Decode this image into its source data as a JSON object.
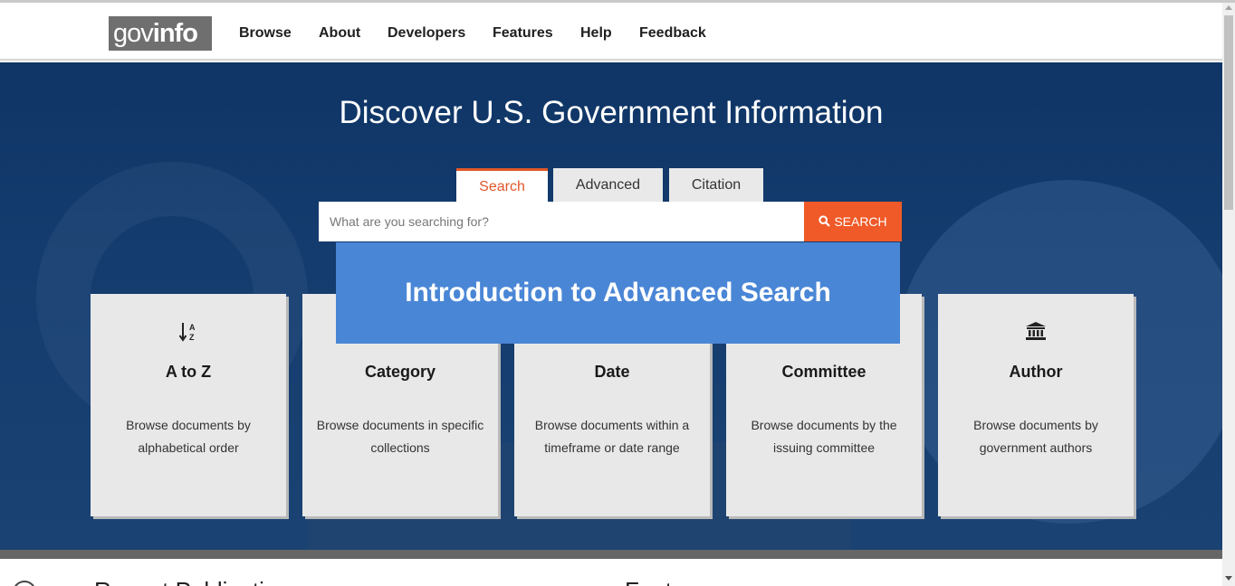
{
  "header": {
    "logo_gov": "gov",
    "logo_info": "info",
    "nav": [
      "Browse",
      "About",
      "Developers",
      "Features",
      "Help",
      "Feedback"
    ]
  },
  "hero": {
    "title": "Discover U.S. Government Information",
    "tabs": [
      "Search",
      "Advanced",
      "Citation"
    ],
    "active_tab": "Search",
    "search": {
      "placeholder": "What are you searching for?",
      "button_label": "SEARCH"
    }
  },
  "overlay": {
    "text": "Introduction to Advanced Search"
  },
  "cards": [
    {
      "icon": "sort-alpha-icon",
      "title": "A to Z",
      "desc": "Browse documents by alphabetical order"
    },
    {
      "icon": "category-icon",
      "title": "Category",
      "desc": "Browse documents in specific collections"
    },
    {
      "icon": "calendar-icon",
      "title": "Date",
      "desc": "Browse documents within a timeframe or date range"
    },
    {
      "icon": "committee-icon",
      "title": "Committee",
      "desc": "Browse documents by the issuing committee"
    },
    {
      "icon": "institution-icon",
      "title": "Author",
      "desc": "Browse documents by government authors"
    }
  ],
  "below": {
    "left_heading": "Recent Publicatio",
    "right_heading": "Feat"
  },
  "colors": {
    "accent": "#f05a28",
    "hero_bg": "#143c6e",
    "overlay_bg": "#4a86d6",
    "card_bg": "#e8e8e8"
  }
}
